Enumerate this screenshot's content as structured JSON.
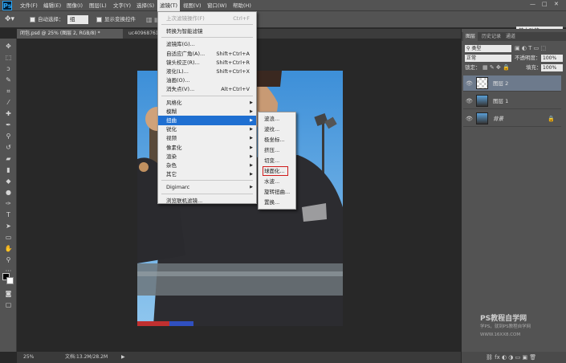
{
  "app": {
    "logo": "Ps"
  },
  "menubar": {
    "items": [
      "文件(F)",
      "编辑(E)",
      "图像(I)",
      "图层(L)",
      "文字(Y)",
      "选择(S)",
      "滤镜(T)",
      "视图(V)",
      "窗口(W)",
      "帮助(H)"
    ],
    "active_index": 6,
    "window_controls": [
      "—",
      "□",
      "✕"
    ]
  },
  "options": {
    "auto_select_label": "自动选择：",
    "auto_select_value": "组",
    "show_transform_label": "显示变换控件",
    "workspace": "基本功能"
  },
  "document": {
    "tab_active": "图层 2, RGB/8",
    "tab_active_prefix": "闭包.psd @ 25%",
    "tab_inactive": "uc4096876153.8..."
  },
  "status": {
    "zoom": "25%",
    "doc_info": "文档:13.2M/28.2M"
  },
  "filter_menu": {
    "items": [
      {
        "label": "上次滤镜操作(F)",
        "shortcut": "Ctrl+F",
        "disabled": true
      },
      {
        "sep": true
      },
      {
        "label": "转换为智能滤镜"
      },
      {
        "sep": true
      },
      {
        "label": "滤镜库(G)..."
      },
      {
        "label": "自适应广角(A)...",
        "shortcut": "Shift+Ctrl+A"
      },
      {
        "label": "镜头校正(R)...",
        "shortcut": "Shift+Ctrl+R"
      },
      {
        "label": "液化(L)...",
        "shortcut": "Shift+Ctrl+X"
      },
      {
        "label": "油画(O)..."
      },
      {
        "label": "消失点(V)...",
        "shortcut": "Alt+Ctrl+V"
      },
      {
        "sep": true
      },
      {
        "label": "风格化",
        "sub": true
      },
      {
        "label": "模糊",
        "sub": true
      },
      {
        "label": "扭曲",
        "sub": true,
        "highlight": true
      },
      {
        "label": "锐化",
        "sub": true
      },
      {
        "label": "视频",
        "sub": true
      },
      {
        "label": "像素化",
        "sub": true
      },
      {
        "label": "渲染",
        "sub": true
      },
      {
        "label": "杂色",
        "sub": true
      },
      {
        "label": "其它",
        "sub": true
      },
      {
        "sep": true
      },
      {
        "label": "Digimarc",
        "sub": true
      },
      {
        "sep": true
      },
      {
        "label": "浏览联机滤镜..."
      }
    ]
  },
  "distort_submenu": {
    "items": [
      "波浪...",
      "波纹...",
      "极坐标...",
      "挤压...",
      "切变...",
      "球面化...",
      "水波...",
      "旋转扭曲...",
      "置换..."
    ],
    "boxed_index": 5
  },
  "panel": {
    "tabs": [
      "图层",
      "历史记录",
      "通道"
    ],
    "kind_label": "类型",
    "blend_mode": "正常",
    "opacity_label": "不透明度：",
    "opacity_value": "100%",
    "lock_label": "锁定：",
    "fill_label": "填充：",
    "fill_value": "100%",
    "layers": [
      {
        "name": "图层 2",
        "active": true
      },
      {
        "name": "图层 1",
        "active": false
      },
      {
        "name": "背景",
        "active": false,
        "locked": true
      }
    ],
    "bottom_icons": "⛓ fx ◐ ◑ ▭ ▣ 🗑"
  },
  "watermark": {
    "title": "PS教程自学网",
    "line2": "学PS，就到PS教程自学网",
    "line3": "WWW.16XX8.COM"
  },
  "colors": {
    "highlight": "#1f6fd1",
    "box_red": "#d01b1b"
  }
}
